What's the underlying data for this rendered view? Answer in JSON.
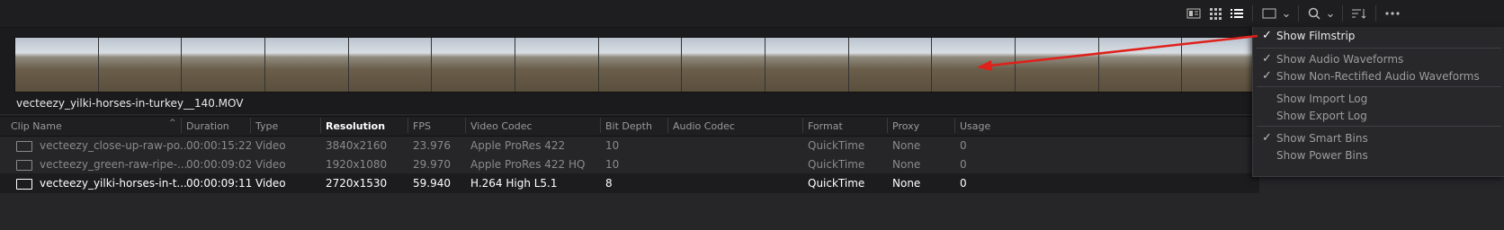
{
  "toolbar": {
    "icons": [
      "thumbnail-view-icon",
      "grid-view-icon",
      "list-view-icon",
      "clip-display-icon",
      "search-icon",
      "sort-icon",
      "more-options-icon"
    ],
    "dropdown_glyph": "⌄"
  },
  "clip": {
    "filename": "vecteezy_yilki-horses-in-turkey__140.MOV"
  },
  "table": {
    "columns": [
      "Clip Name",
      "Duration",
      "Type",
      "Resolution",
      "FPS",
      "Video Codec",
      "Bit Depth",
      "Audio Codec",
      "Format",
      "Proxy",
      "Usage"
    ],
    "sorted_column": "Resolution",
    "rows": [
      {
        "name": "vecteezy_close-up-raw-po...",
        "duration": "00:00:15:22",
        "type": "Video",
        "resolution": "3840x2160",
        "fps": "23.976",
        "codec": "Apple ProRes 422",
        "bit_depth": "10",
        "audio_codec": "",
        "format": "QuickTime",
        "proxy": "None",
        "usage": "0"
      },
      {
        "name": "vecteezy_green-raw-ripe-...",
        "duration": "00:00:09:02",
        "type": "Video",
        "resolution": "1920x1080",
        "fps": "29.970",
        "codec": "Apple ProRes 422 HQ",
        "bit_depth": "10",
        "audio_codec": "",
        "format": "QuickTime",
        "proxy": "None",
        "usage": "0"
      },
      {
        "name": "vecteezy_yilki-horses-in-t...",
        "duration": "00:00:09:11",
        "type": "Video",
        "resolution": "2720x1530",
        "fps": "59.940",
        "codec": "H.264 High L5.1",
        "bit_depth": "8",
        "audio_codec": "",
        "format": "QuickTime",
        "proxy": "None",
        "usage": "0"
      }
    ]
  },
  "menu": {
    "items": [
      {
        "label": "Show Filmstrip",
        "checked": "✓"
      },
      {
        "label": "Show Audio Waveforms",
        "checked": "✓"
      },
      {
        "label": "Show Non-Rectified Audio Waveforms",
        "checked": "✓"
      },
      {
        "label": "Show Import Log",
        "checked": ""
      },
      {
        "label": "Show Export Log",
        "checked": ""
      },
      {
        "label": "Show Smart Bins",
        "checked": "✓"
      },
      {
        "label": "Show Power Bins",
        "checked": ""
      }
    ]
  },
  "colors": {
    "background": "#262629",
    "annotation_arrow": "#e0201b",
    "menu_bg": "#28282b"
  }
}
